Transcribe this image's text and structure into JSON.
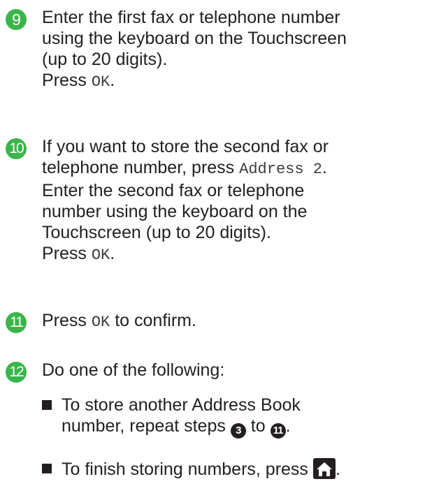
{
  "steps": [
    {
      "number": "9",
      "lines": [
        "Enter the first fax or telephone number",
        "using the keyboard on the Touchscreen",
        "(up to 20 digits)."
      ],
      "press_prefix": "Press ",
      "press_key": "OK",
      "press_suffix": "."
    },
    {
      "number": "10",
      "line1_text": "If you want to store the second fax or",
      "line2_text": "telephone number, press ",
      "line2_key": "Address 2",
      "line2_suffix": ".",
      "lines": [
        "Enter the second fax or telephone",
        "number using the keyboard on the",
        "Touchscreen (up to 20 digits)."
      ],
      "press_prefix": "Press ",
      "press_key": "OK",
      "press_suffix": "."
    },
    {
      "number": "11",
      "prefix": "Press ",
      "key": "OK",
      "suffix": " to confirm."
    },
    {
      "number": "12",
      "intro": "Do one of the following:",
      "bullets": [
        {
          "line1": "To store another Address Book",
          "line2_prefix": "number, repeat steps ",
          "ref_a": "3",
          "middle": " to ",
          "ref_b": "11",
          "suffix": "."
        },
        {
          "prefix": "To finish storing numbers, press ",
          "icon": "home-icon",
          "suffix": "."
        }
      ]
    }
  ],
  "colors": {
    "step_badge": "#39b54a",
    "text": "#231f20"
  }
}
